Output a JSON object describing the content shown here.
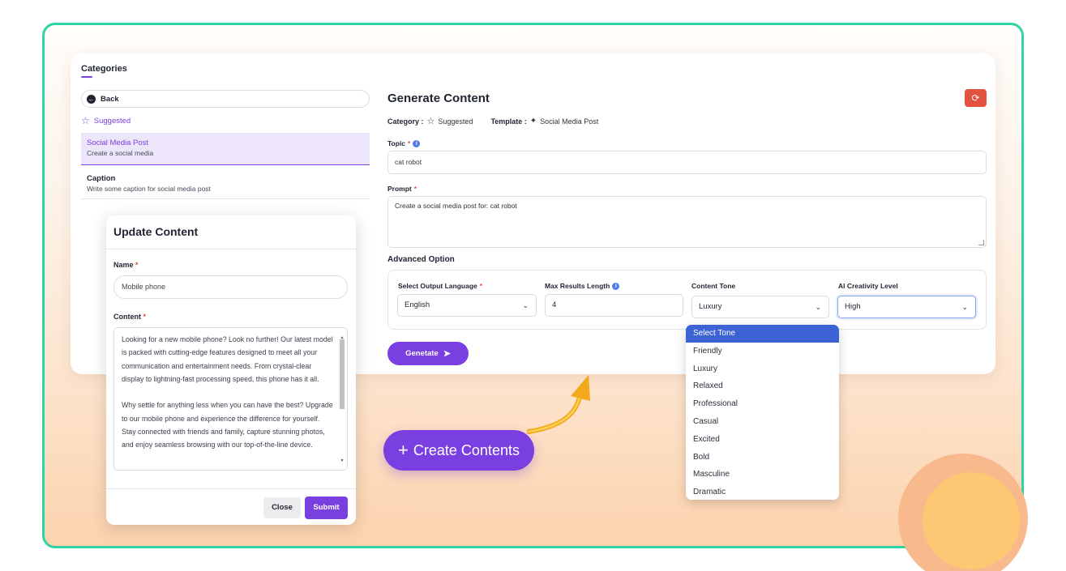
{
  "sidebar": {
    "title": "Categories",
    "back_label": "Back",
    "suggested_label": "Suggested",
    "templates": [
      {
        "name": "Social Media Post",
        "desc": "Create a social media"
      },
      {
        "name": "Caption",
        "desc": "Write some caption for social media post"
      }
    ]
  },
  "generate": {
    "title": "Generate Content",
    "category_label": "Category :",
    "category_value": "Suggested",
    "template_label": "Template :",
    "template_value": "Social Media Post",
    "topic_label": "Topic",
    "topic_value": "cat robot",
    "prompt_label": "Prompt",
    "prompt_value": "Create a social media post for: cat robot",
    "advanced_title": "Advanced Option",
    "language_label": "Select Output Language",
    "language_value": "English",
    "max_length_label": "Max Results Length",
    "max_length_value": "4",
    "tone_label": "Content Tone",
    "tone_value": "Luxury",
    "creativity_label": "AI Creativity Level",
    "creativity_value": "High",
    "generate_button": "Genetate"
  },
  "tone_options": [
    "Select Tone",
    "Friendly",
    "Luxury",
    "Relaxed",
    "Professional",
    "Casual",
    "Excited",
    "Bold",
    "Masculine",
    "Dramatic"
  ],
  "modal": {
    "title": "Update Content",
    "name_label": "Name",
    "name_value": "Mobile phone",
    "content_label": "Content",
    "content_p1": "Looking for a new mobile phone? Look no further! Our latest model is packed with cutting-edge features designed to meet all your communication and entertainment needs. From crystal-clear display to lightning-fast processing speed, this phone has it all.",
    "content_p2": "Why settle for anything less when you can have the best? Upgrade to our mobile phone and experience the difference for yourself. Stay connected with friends and family, capture stunning photos, and enjoy seamless browsing with our top-of-the-line device.",
    "close_button": "Close",
    "submit_button": "Submit"
  },
  "promo": {
    "create_button": "Create Contents"
  },
  "colors": {
    "accent": "#7a3fe0",
    "frame_border": "#2fd3a4",
    "refresh": "#e2523f",
    "dropdown_selected": "#3d62d6"
  }
}
